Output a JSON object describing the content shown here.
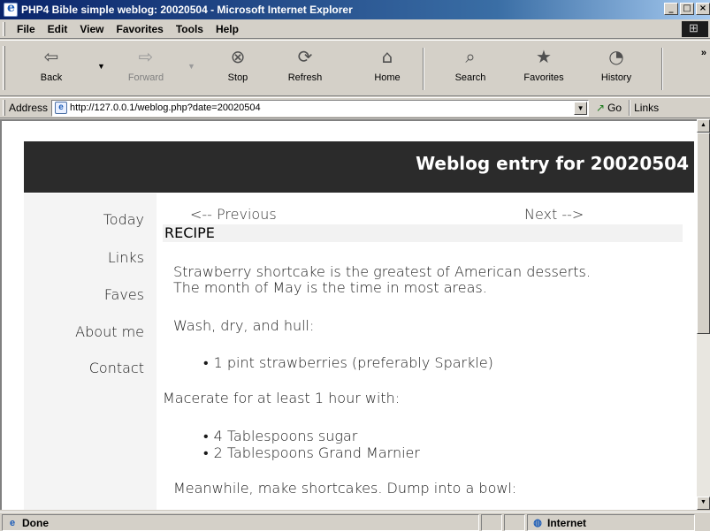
{
  "window": {
    "title": "PHP4 Bible simple weblog: 20020504 - Microsoft Internet Explorer"
  },
  "title_buttons": {
    "minimize": "_",
    "maximize": "□",
    "close": "×"
  },
  "menu": {
    "items": [
      {
        "label": "File"
      },
      {
        "label": "Edit"
      },
      {
        "label": "View"
      },
      {
        "label": "Favorites"
      },
      {
        "label": "Tools"
      },
      {
        "label": "Help"
      }
    ]
  },
  "toolbar": {
    "back": "Back",
    "forward": "Forward",
    "stop": "Stop",
    "refresh": "Refresh",
    "home": "Home",
    "search": "Search",
    "favorites": "Favorites",
    "history": "History",
    "more": "»"
  },
  "address": {
    "label": "Address",
    "url": "http://127.0.0.1/weblog.php?date=20020504",
    "go": "Go",
    "links": "Links"
  },
  "page": {
    "header_title": "Weblog entry for 20020504",
    "nav": [
      "Today",
      "Links",
      "Faves",
      "About me",
      "Contact"
    ],
    "prev_link": "<-- Previous",
    "next_link": "Next -->",
    "entry_heading": "RECIPE",
    "para1_line1": "Strawberry shortcake is the greatest of American desserts.",
    "para1_line2": "The month of May is the time in most areas.",
    "para2": "Wash, dry, and hull:",
    "list1": [
      "1 pint strawberries (preferably Sparkle)"
    ],
    "para3": "Macerate for at least 1 hour with:",
    "list2": [
      "4 Tablespoons sugar",
      "2 Tablespoons Grand Marnier"
    ],
    "para4": "Meanwhile, make shortcakes. Dump into a bowl:"
  },
  "status": {
    "text": "Done",
    "zone": "Internet"
  },
  "colors": {
    "title_bar": "#0a246a",
    "header_band": "#2b2b2b",
    "chrome": "#d4d0c8"
  }
}
